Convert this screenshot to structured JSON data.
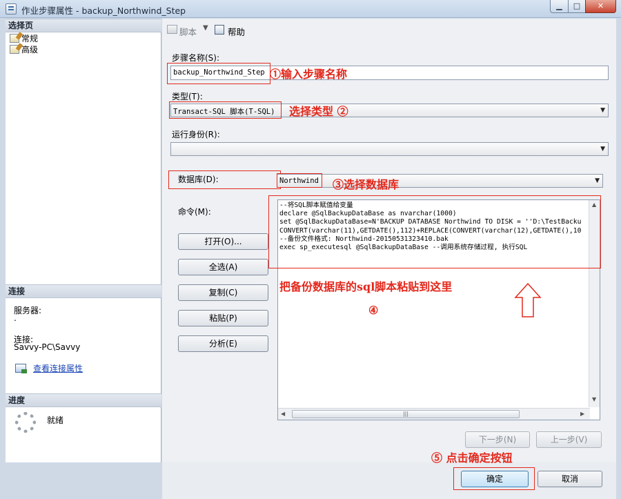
{
  "window": {
    "title": "作业步骤属性 - backup_Northwind_Step",
    "min": "▁",
    "max": "□",
    "close": "✕"
  },
  "left": {
    "select_page_header": "选择页",
    "pages": [
      {
        "label": "常规"
      },
      {
        "label": "高级"
      }
    ],
    "connection_header": "连接",
    "server_label": "服务器:",
    "server_value": ".",
    "connection_label": "连接:",
    "connection_value": "Savvy-PC\\Savvy",
    "view_conn_props": "查看连接属性",
    "progress_header": "进度",
    "progress_status": "就绪"
  },
  "toolbar": {
    "script_label": "脚本",
    "script_dropdown": "▼",
    "help_label": "帮助"
  },
  "form": {
    "step_name_label": "步骤名称(S):",
    "step_name_value": "backup_Northwind_Step",
    "type_label": "类型(T):",
    "type_value": "Transact-SQL 脚本(T-SQL)",
    "run_as_label": "运行身份(R):",
    "run_as_value": "",
    "database_label": "数据库(D):",
    "database_value": "Northwind",
    "command_label": "命令(M):",
    "command_text": "--将SQL脚本赋值给变量\ndeclare @SqlBackupDataBase as nvarchar(1000)\nset @SqlBackupDataBase=N'BACKUP DATABASE Northwind TO DISK = ''D:\\TestBacku\nCONVERT(varchar(11),GETDATE(),112)+REPLACE(CONVERT(varchar(12),GETDATE(),10\n--备份文件格式: Northwind-20150531323410.bak\nexec sp_executesql @SqlBackupDataBase --调用系统存储过程, 执行SQL",
    "scroll_up": "▲",
    "scroll_down": "▼",
    "scroll_left": "◀",
    "scroll_right": "▶",
    "scroll_thumb": "|||"
  },
  "buttons": {
    "open": "打开(O)...",
    "select_all": "全选(A)",
    "copy": "复制(C)",
    "paste": "粘贴(P)",
    "parse": "分析(E)",
    "next_step": "下一步(N)",
    "prev_step": "上一步(V)",
    "ok": "确定",
    "cancel": "取消"
  },
  "annotations": {
    "a1": "①输入步骤名称",
    "a2": "选择类型 ②",
    "a3": "③选择数据库",
    "a4_text": "把备份数据库的sql脚本粘贴到这里",
    "a4_num": "④",
    "a5": "⑤ 点击确定按钮"
  },
  "colors": {
    "annotation_red": "#e3281c",
    "link_blue": "#1a45b5"
  }
}
